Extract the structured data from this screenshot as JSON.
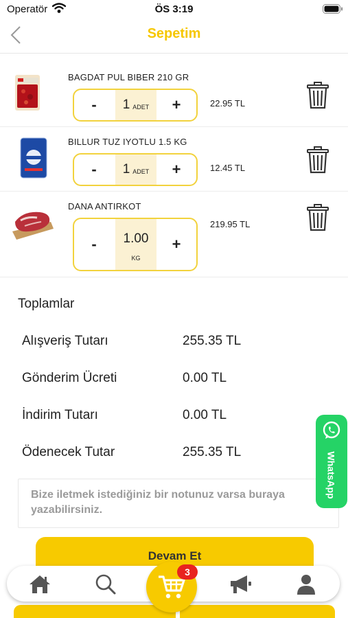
{
  "status_bar": {
    "carrier": "Operatör",
    "time": "ÖS 3:19"
  },
  "nav": {
    "title": "Sepetim"
  },
  "cart_items": [
    {
      "name": "BAGDAT PUL BIBER 210 GR",
      "qty": "1",
      "unit": "ADET",
      "price": "22.95 TL"
    },
    {
      "name": "BILLUR TUZ IYOTLU 1.5 KG",
      "qty": "1",
      "unit": "ADET",
      "price": "12.45 TL"
    },
    {
      "name": "DANA ANTIRKOT",
      "qty": "1.00",
      "unit": "KG",
      "price": "219.95 TL"
    }
  ],
  "stepper": {
    "minus": "-",
    "plus": "+"
  },
  "totals": {
    "heading": "Toplamlar",
    "rows": [
      {
        "label": "Alışveriş Tutarı",
        "value": "255.35 TL"
      },
      {
        "label": "Gönderim Ücreti",
        "value": "0.00 TL"
      },
      {
        "label": "İndirim Tutarı",
        "value": "0.00 TL"
      },
      {
        "label": "Ödenecek Tutar",
        "value": "255.35 TL"
      }
    ]
  },
  "note": {
    "line1": "Bize iletmek istediğiniz bir notunuz varsa buraya",
    "line2": "yazabilirsiniz."
  },
  "whatsapp": {
    "label": "WhatsApp"
  },
  "continue_button": {
    "label": "Devam Et"
  },
  "tab_bar": {
    "cart_badge": "3",
    "icons": [
      "home-icon",
      "search-icon",
      "cart-icon",
      "megaphone-icon",
      "profile-icon"
    ]
  },
  "colors": {
    "accent": "#f7ca00",
    "title": "#f6c700",
    "stepper_border": "#f2d23c",
    "badge": "#e8231f",
    "whatsapp": "#25d366"
  }
}
